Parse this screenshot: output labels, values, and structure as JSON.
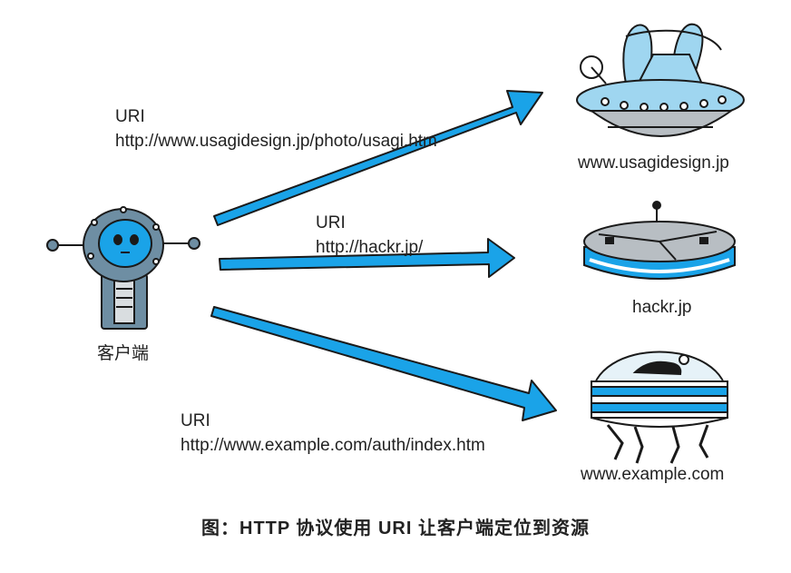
{
  "client": {
    "label": "客户端"
  },
  "uri_labels": [
    {
      "title": "URI",
      "uri": "http://www.usagidesign.jp/photo/usagi.htm"
    },
    {
      "title": "URI",
      "uri": "http://hackr.jp/"
    },
    {
      "title": "URI",
      "uri": "http://www.example.com/auth/index.htm"
    }
  ],
  "servers": [
    {
      "host": "www.usagidesign.jp",
      "icon": "rabbit-ufo-icon"
    },
    {
      "host": "hackr.jp",
      "icon": "flying-saucer-icon"
    },
    {
      "host": "www.example.com",
      "icon": "dome-walker-icon"
    }
  ],
  "caption": "图：HTTP 协议使用 URI 让客户端定位到资源",
  "colors": {
    "arrow": "#1aa3e8",
    "outline": "#1a1a1a",
    "robot_body": "#6e8ea3",
    "ship_blue": "#9fd6f0",
    "ship_gray": "#b8bec3"
  }
}
